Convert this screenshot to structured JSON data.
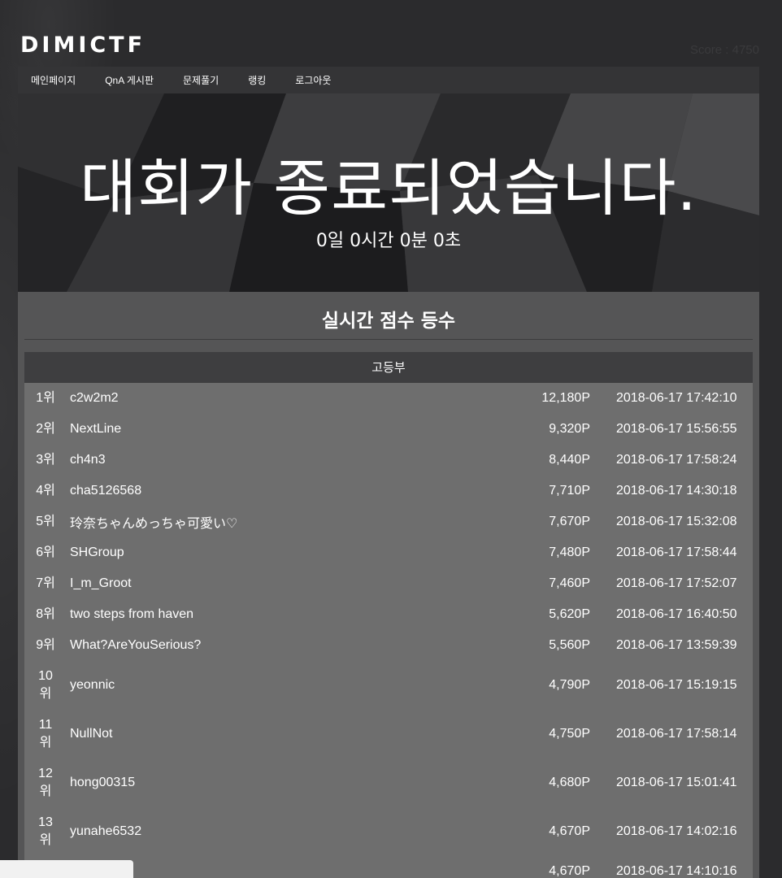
{
  "header": {
    "logo": "DIMICTF",
    "score_text": "Score : 4750"
  },
  "nav": {
    "items": [
      "메인페이지",
      "QnA 게시판",
      "문제풀기",
      "랭킹",
      "로그아웃"
    ]
  },
  "hero": {
    "title": "대회가 종료되었습니다.",
    "countdown": "0일 0시간 0분 0초"
  },
  "ranking": {
    "title": "실시간 점수 등수",
    "division": "고등부",
    "rows": [
      {
        "rank": "1위",
        "name": "c2w2m2",
        "score": "12,180P",
        "time": "2018-06-17 17:42:10"
      },
      {
        "rank": "2위",
        "name": "NextLine",
        "score": "9,320P",
        "time": "2018-06-17 15:56:55"
      },
      {
        "rank": "3위",
        "name": "ch4n3",
        "score": "8,440P",
        "time": "2018-06-17 17:58:24"
      },
      {
        "rank": "4위",
        "name": "cha5126568",
        "score": "7,710P",
        "time": "2018-06-17 14:30:18"
      },
      {
        "rank": "5위",
        "name": "玲奈ちゃんめっちゃ可愛い♡",
        "score": "7,670P",
        "time": "2018-06-17 15:32:08"
      },
      {
        "rank": "6위",
        "name": "SHGroup",
        "score": "7,480P",
        "time": "2018-06-17 17:58:44"
      },
      {
        "rank": "7위",
        "name": "I_m_Groot",
        "score": "7,460P",
        "time": "2018-06-17 17:52:07"
      },
      {
        "rank": "8위",
        "name": "two steps from haven",
        "score": "5,620P",
        "time": "2018-06-17 16:40:50"
      },
      {
        "rank": "9위",
        "name": "What?AreYouSerious?",
        "score": "5,560P",
        "time": "2018-06-17 13:59:39"
      },
      {
        "rank": "10위",
        "name": "yeonnic",
        "score": "4,790P",
        "time": "2018-06-17 15:19:15"
      },
      {
        "rank": "11위",
        "name": "NullNot",
        "score": "4,750P",
        "time": "2018-06-17 17:58:14"
      },
      {
        "rank": "12위",
        "name": "hong00315",
        "score": "4,680P",
        "time": "2018-06-17 15:01:41"
      },
      {
        "rank": "13위",
        "name": "yunahe6532",
        "score": "4,670P",
        "time": "2018-06-17 14:02:16"
      },
      {
        "rank": "",
        "name": "",
        "score": "4,670P",
        "time": "2018-06-17 14:10:16"
      }
    ]
  }
}
